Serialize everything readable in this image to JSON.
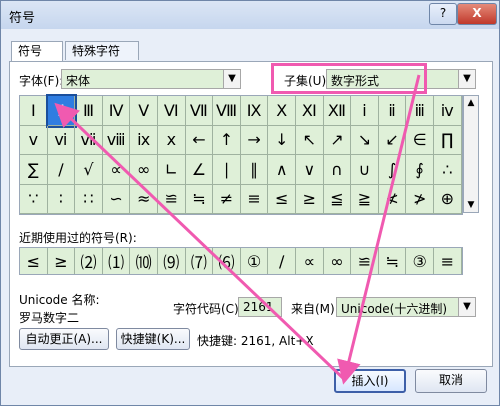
{
  "window": {
    "title": "符号",
    "help_label": "?",
    "close_label": "X"
  },
  "tabs": [
    {
      "label": "符号(S)"
    },
    {
      "label": "特殊字符(P)"
    }
  ],
  "font": {
    "label": "字体(F):",
    "value": "宋体"
  },
  "subset": {
    "label": "子集(U):",
    "value": "数字形式"
  },
  "symbols": [
    [
      "Ⅰ",
      "Ⅱ",
      "Ⅲ",
      "Ⅳ",
      "Ⅴ",
      "Ⅵ",
      "Ⅶ",
      "Ⅷ",
      "Ⅸ",
      "Ⅹ",
      "Ⅺ",
      "Ⅻ",
      "ⅰ",
      "ⅱ",
      "ⅲ",
      "ⅳ"
    ],
    [
      "ⅴ",
      "ⅵ",
      "ⅶ",
      "ⅷ",
      "ⅸ",
      "ⅹ",
      "←",
      "↑",
      "→",
      "↓",
      "↖",
      "↗",
      "↘",
      "↙",
      "∈",
      "∏"
    ],
    [
      "∑",
      "∕",
      "√",
      "∝",
      "∞",
      "∟",
      "∠",
      "∣",
      "∥",
      "∧",
      "∨",
      "∩",
      "∪",
      "∫",
      "∮",
      "∴"
    ],
    [
      "∵",
      "∶",
      "∷",
      "∽",
      "≈",
      "≌",
      "≒",
      "≠",
      "≡",
      "≤",
      "≥",
      "≦",
      "≧",
      "≮",
      "≯",
      "⊕"
    ]
  ],
  "recent": {
    "label": "近期使用过的符号(R):",
    "items": [
      "≤",
      "≥",
      "⑵",
      "⑴",
      "⑽",
      "⑼",
      "⑺",
      "⑹",
      "①",
      "∕",
      "∝",
      "∞",
      "≌",
      "≒",
      "③",
      "≡"
    ]
  },
  "unicode_name": {
    "label": "Unicode 名称:",
    "value": "罗马数字二"
  },
  "char_code": {
    "label": "字符代码(C):",
    "value": "2161"
  },
  "from": {
    "label": "来自(M):",
    "value": "Unicode(十六进制)"
  },
  "autocorrect_label": "自动更正(A)...",
  "shortcut_key_label": "快捷键(K)...",
  "shortcut_text": "快捷键: 2161, Alt+X",
  "insert_label": "插入(I)",
  "cancel_label": "取消",
  "colors": {
    "grid_bg": "#dff0d8",
    "highlight": "#f05ab0",
    "selected": "#2f7de1"
  }
}
